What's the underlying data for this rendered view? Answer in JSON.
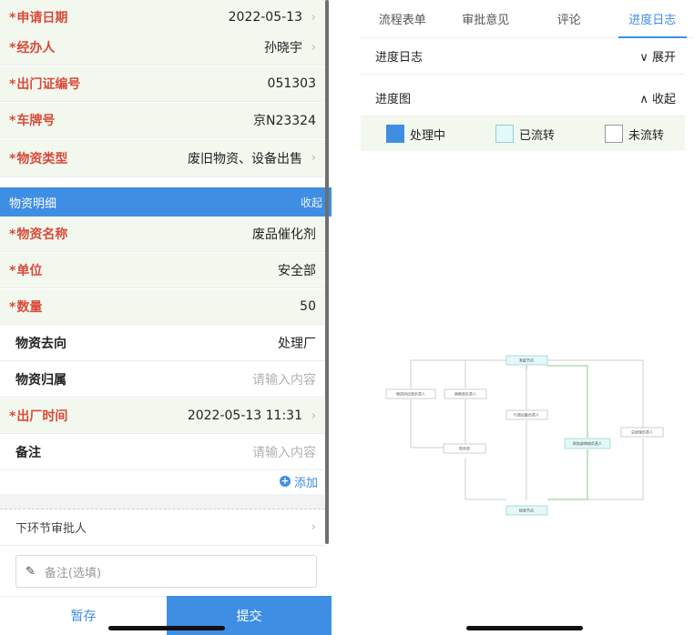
{
  "form": {
    "rows": [
      {
        "label": "申请日期",
        "value": "2022-05-13",
        "required": true,
        "chevron": true
      },
      {
        "label": "经办人",
        "value": "孙晓宇",
        "required": true,
        "chevron": true
      },
      {
        "label": "出门证编号",
        "value": "051303",
        "required": true,
        "chevron": false
      },
      {
        "label": "车牌号",
        "value": "京N23324",
        "required": true,
        "chevron": false
      },
      {
        "label": "物资类型",
        "value": "废旧物资、设备出售",
        "required": true,
        "chevron": true
      }
    ],
    "section": {
      "title": "物资明细",
      "collapse": "收起"
    },
    "detail_rows": [
      {
        "label": "物资名称",
        "value": "废品催化剂",
        "required": true
      },
      {
        "label": "单位",
        "value": "安全部",
        "required": true
      },
      {
        "label": "数量",
        "value": "50",
        "required": true
      },
      {
        "label": "物资去向",
        "value": "处理厂",
        "required": false,
        "placeholder": false
      },
      {
        "label": "物资归属",
        "value": "请输入内容",
        "required": false,
        "placeholder": true
      },
      {
        "label": "出厂时间",
        "value": "2022-05-13 11:31",
        "required": true,
        "chevron": true
      },
      {
        "label": "备注",
        "value": "请输入内容",
        "required": false,
        "placeholder": true
      }
    ],
    "add_label": "添加",
    "next_approver_label": "下环节审批人",
    "note_placeholder": "备注(选填)",
    "save_label": "暂存",
    "submit_label": "提交"
  },
  "right": {
    "tabs": [
      {
        "label": "流程表单",
        "active": false
      },
      {
        "label": "审批意见",
        "active": false
      },
      {
        "label": "评论",
        "active": false
      },
      {
        "label": "进度日志",
        "active": true
      }
    ],
    "log_title": "进度日志",
    "log_toggle": "∨ 展开",
    "chart_title": "进度图",
    "chart_toggle": "∧ 收起",
    "legend": [
      {
        "label": "处理中",
        "swatch": "processing"
      },
      {
        "label": "已流转",
        "swatch": "flowed"
      },
      {
        "label": "未流转",
        "swatch": "notflowed"
      }
    ],
    "flow_nodes": {
      "start": "发起节点",
      "n1": "物资供应部负责人",
      "n2": "销售部负责人",
      "n3": "行政后勤负责人",
      "n4": "财务部",
      "n5": "财务部审核负责人",
      "n6": "总经理负责人",
      "end": "结束节点"
    }
  },
  "colors": {
    "accent": "#3e8ee4",
    "required": "#d94a3a",
    "flowed": "#e3f8f8"
  }
}
